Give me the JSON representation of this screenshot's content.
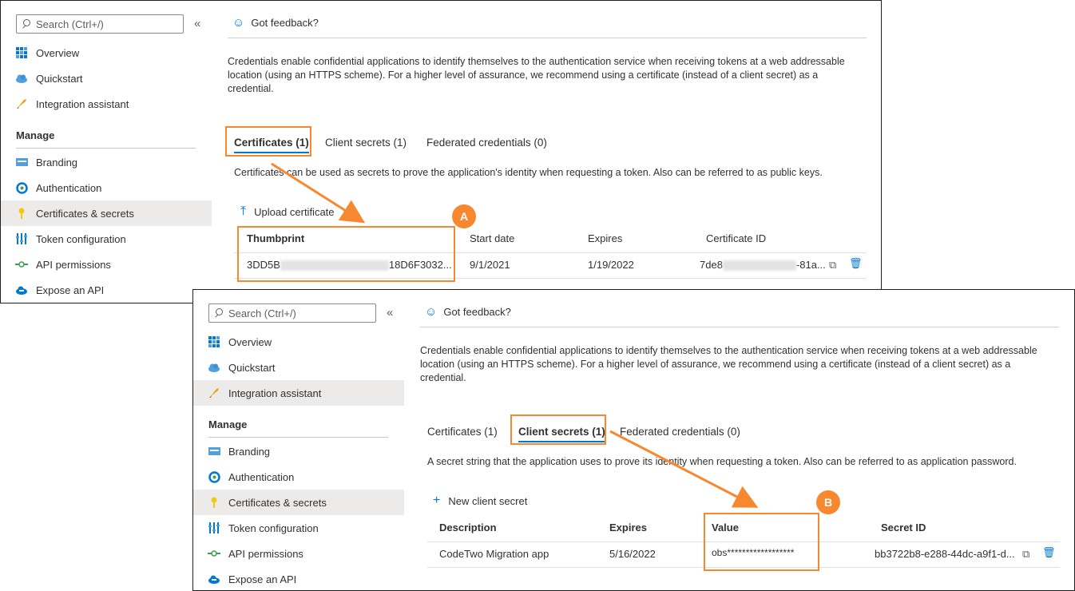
{
  "colors": {
    "accent": "#0078d4",
    "highlight": "#f7882f",
    "selected_bg": "#edebe9"
  },
  "screen_a": {
    "search_placeholder": "Search (Ctrl+/)",
    "collapse": "«",
    "nav": [
      {
        "label": "Overview",
        "icon": "grid-icon"
      },
      {
        "label": "Quickstart",
        "icon": "cloud-icon"
      },
      {
        "label": "Integration assistant",
        "icon": "rocket-icon"
      }
    ],
    "manage_section": "Manage",
    "manage_nav": [
      {
        "label": "Branding",
        "icon": "branding-icon"
      },
      {
        "label": "Authentication",
        "icon": "auth-icon"
      },
      {
        "label": "Certificates & secrets",
        "icon": "key-icon",
        "selected": true
      },
      {
        "label": "Token configuration",
        "icon": "token-icon"
      },
      {
        "label": "API permissions",
        "icon": "api-icon"
      },
      {
        "label": "Expose an API",
        "icon": "cloud-api-icon"
      }
    ],
    "feedback": "Got feedback?",
    "description": "Credentials enable confidential applications to identify themselves to the authentication service when receiving tokens at a web addressable location (using an HTTPS scheme). For a higher level of assurance, we recommend using a certificate (instead of a client secret) as a credential.",
    "tabs": [
      {
        "label": "Certificates (1)",
        "active": true
      },
      {
        "label": "Client secrets (1)",
        "active": false
      },
      {
        "label": "Federated credentials (0)",
        "active": false
      }
    ],
    "tab_hint": "Certificates can be used as secrets to prove the application's identity when requesting a token. Also can be referred to as public keys.",
    "action": "Upload certificate",
    "columns": [
      "Thumbprint",
      "Start date",
      "Expires",
      "Certificate ID"
    ],
    "row": {
      "thumb_start": "3DD5B",
      "thumb_end": "18D6F3032...",
      "start_date": "9/1/2021",
      "expires": "1/19/2022",
      "id_start": "7de8",
      "id_end": "-81a..."
    },
    "badge": "A"
  },
  "screen_b": {
    "search_placeholder": "Search (Ctrl+/)",
    "collapse": "«",
    "nav": [
      {
        "label": "Overview",
        "icon": "grid-icon"
      },
      {
        "label": "Quickstart",
        "icon": "cloud-icon"
      },
      {
        "label": "Integration assistant",
        "icon": "rocket-icon",
        "selected": true
      }
    ],
    "manage_section": "Manage",
    "manage_nav": [
      {
        "label": "Branding",
        "icon": "branding-icon"
      },
      {
        "label": "Authentication",
        "icon": "auth-icon"
      },
      {
        "label": "Certificates & secrets",
        "icon": "key-icon",
        "selected": true
      },
      {
        "label": "Token configuration",
        "icon": "token-icon"
      },
      {
        "label": "API permissions",
        "icon": "api-icon"
      },
      {
        "label": "Expose an API",
        "icon": "cloud-api-icon"
      }
    ],
    "feedback": "Got feedback?",
    "description": "Credentials enable confidential applications to identify themselves to the authentication service when receiving tokens at a web addressable location (using an HTTPS scheme). For a higher level of assurance, we recommend using a certificate (instead of a client secret) as a credential.",
    "tabs": [
      {
        "label": "Certificates (1)",
        "active": false
      },
      {
        "label": "Client secrets (1)",
        "active": true
      },
      {
        "label": "Federated credentials (0)",
        "active": false
      }
    ],
    "tab_hint": "A secret string that the application uses to prove its identity when requesting a token. Also can be referred to as application password.",
    "action": "New client secret",
    "columns": [
      "Description",
      "Expires",
      "Value",
      "Secret ID"
    ],
    "row": {
      "description": "CodeTwo Migration app",
      "expires": "5/16/2022",
      "value": "obs******************",
      "secret_id": "bb3722b8-e288-44dc-a9f1-d..."
    },
    "badge": "B"
  }
}
